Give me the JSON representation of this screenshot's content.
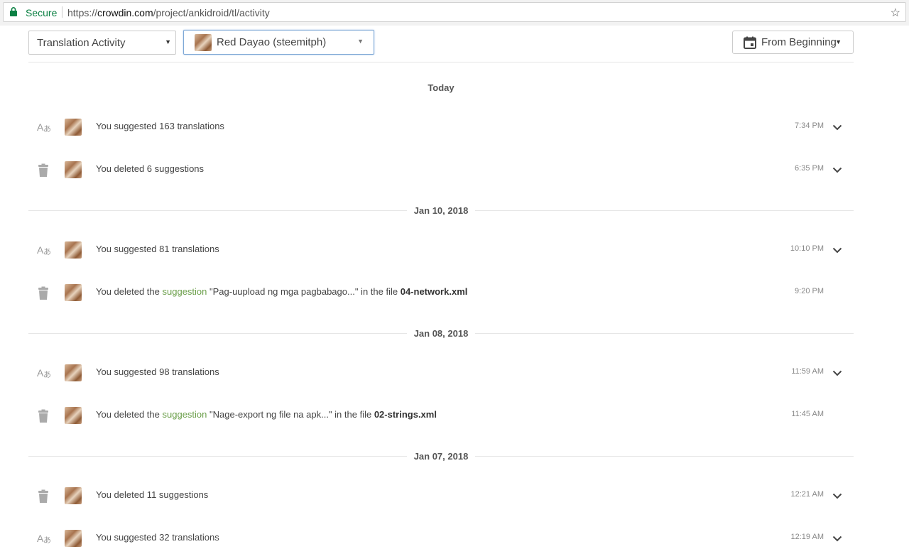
{
  "browser": {
    "secure_label": "Secure",
    "url_scheme": "https://",
    "url_host": "crowdin.com",
    "url_path": "/project/ankidroid/tl/activity"
  },
  "filters": {
    "activity_type": "Translation Activity",
    "user": "Red Dayao (steemitph)",
    "period": "From Beginning"
  },
  "groups": [
    {
      "date": "Today",
      "items": [
        {
          "type": "suggest-icon",
          "text": "You suggested 163 translations",
          "time": "7:34 PM",
          "expand": true
        },
        {
          "type": "trash-icon",
          "text": "You deleted 6 suggestions",
          "time": "6:35 PM",
          "expand": true
        }
      ]
    },
    {
      "date": "Jan 10, 2018",
      "items": [
        {
          "type": "suggest-icon",
          "text": "You suggested 81 translations",
          "time": "10:10 PM",
          "expand": true
        },
        {
          "type": "trash-icon",
          "pre": "You deleted the ",
          "link": "suggestion",
          "mid": " \"Pag-uupload ng mga pagbabago...\" in the file ",
          "file": "04-network.xml",
          "time": "9:20 PM",
          "expand": false
        }
      ]
    },
    {
      "date": "Jan 08, 2018",
      "items": [
        {
          "type": "suggest-icon",
          "text": "You suggested 98 translations",
          "time": "11:59 AM",
          "expand": true
        },
        {
          "type": "trash-icon",
          "pre": "You deleted the ",
          "link": "suggestion",
          "mid": " \"Nage-export ng file na apk...\" in the file ",
          "file": "02-strings.xml",
          "time": "11:45 AM",
          "expand": false
        }
      ]
    },
    {
      "date": "Jan 07, 2018",
      "items": [
        {
          "type": "trash-icon",
          "text": "You deleted 11 suggestions",
          "time": "12:21 AM",
          "expand": true
        },
        {
          "type": "suggest-icon",
          "text": "You suggested 32 translations",
          "time": "12:19 AM",
          "expand": true
        }
      ]
    }
  ],
  "colors": {
    "link": "#6b9f4a",
    "secure": "#0b8043",
    "focus_border": "#7fa9d6"
  }
}
